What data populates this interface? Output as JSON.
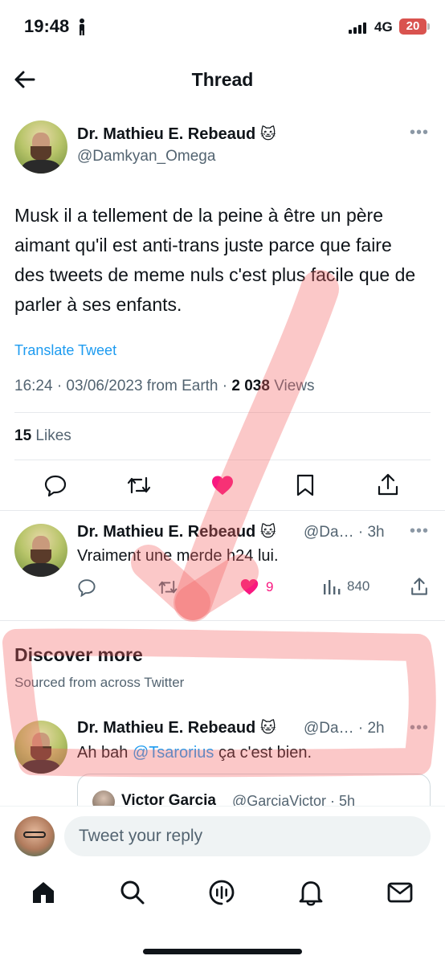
{
  "status_bar": {
    "time": "19:48",
    "network": "4G",
    "battery": "20"
  },
  "header": {
    "title": "Thread"
  },
  "main_tweet": {
    "author_name": "Dr. Mathieu E. Rebeaud",
    "author_emoji": "🐱",
    "handle": "@Damkyan_Omega",
    "text": "Musk il a tellement de la peine à être un père aimant qu'il est anti-trans juste parce que faire des tweets de meme nuls c'est plus facile que de parler à ses enfants.",
    "translate_label": "Translate Tweet",
    "timestamp": "16:24 · 03/06/2023 from Earth · ",
    "views_count": "2 038",
    "views_label": " Views",
    "likes_count": "15",
    "likes_label": " Likes"
  },
  "reply_tweet": {
    "author_name": "Dr. Mathieu E. Rebeaud",
    "author_emoji": "🐱",
    "handle_time": "@Da… · 3h",
    "text": "Vraiment une merde h24 lui.",
    "likes": "9",
    "views": "840"
  },
  "discover": {
    "title": "Discover more",
    "subtitle": "Sourced from across Twitter"
  },
  "discover_tweet": {
    "author_name": "Dr. Mathieu E. Rebeaud",
    "author_emoji": "🐱",
    "handle_time": "@Da… · 2h",
    "text_before": "Ah bah ",
    "mention": "@Tsarorius",
    "text_after": " ça c'est bien.",
    "quote_name": "Victor Garcia",
    "quote_handle_time": "@GarciaVictor · 5h"
  },
  "compose": {
    "placeholder": "Tweet your reply"
  },
  "tabs": [
    "home-icon",
    "search-icon",
    "spaces-icon",
    "notifications-icon",
    "messages-icon"
  ],
  "colors": {
    "accent": "#1d9bf0",
    "like": "#f91880",
    "text": "#0f1419",
    "muted": "#536471",
    "annotation": "#f46060"
  }
}
